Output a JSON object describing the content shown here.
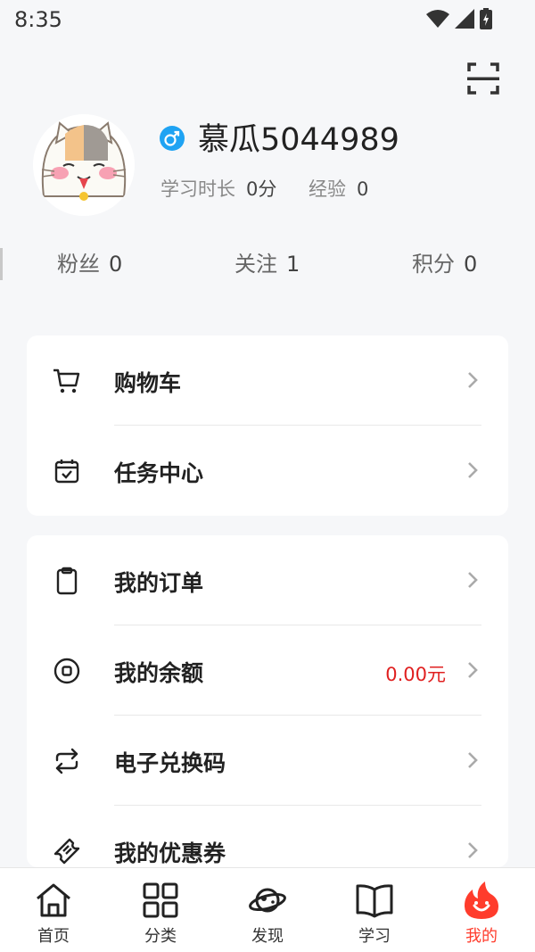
{
  "status_bar": {
    "time": "8:35"
  },
  "header": {
    "scan_icon": "scan-icon"
  },
  "profile": {
    "avatar_icon": "cat-avatar",
    "gender_icon": "male-icon",
    "gender_color": "#1fa3f3",
    "username": "慕瓜5044989",
    "study_time_label": "学习时长",
    "study_time_value": "0分",
    "exp_label": "经验",
    "exp_value": "0"
  },
  "social": {
    "fans_label": "粉丝",
    "fans_value": "0",
    "follow_label": "关注",
    "follow_value": "1",
    "points_label": "积分",
    "points_value": "0"
  },
  "menu_group_1": [
    {
      "label": "购物车",
      "icon": "cart-icon"
    },
    {
      "label": "任务中心",
      "icon": "calendar-check-icon"
    }
  ],
  "menu_group_2": [
    {
      "label": "我的订单",
      "icon": "clipboard-icon"
    },
    {
      "label": "我的余额",
      "icon": "coin-icon",
      "extra": "0.00元"
    },
    {
      "label": "电子兑换码",
      "icon": "exchange-icon"
    },
    {
      "label": "我的优惠券",
      "icon": "ticket-icon"
    }
  ],
  "colors": {
    "accent": "#ff3c2c",
    "balance": "#e02020",
    "background": "#f6f7f9"
  },
  "tabs": [
    {
      "label": "首页",
      "icon": "home-icon"
    },
    {
      "label": "分类",
      "icon": "grid-icon"
    },
    {
      "label": "发现",
      "icon": "planet-icon"
    },
    {
      "label": "学习",
      "icon": "book-icon"
    },
    {
      "label": "我的",
      "icon": "flame-icon",
      "active": true
    }
  ]
}
